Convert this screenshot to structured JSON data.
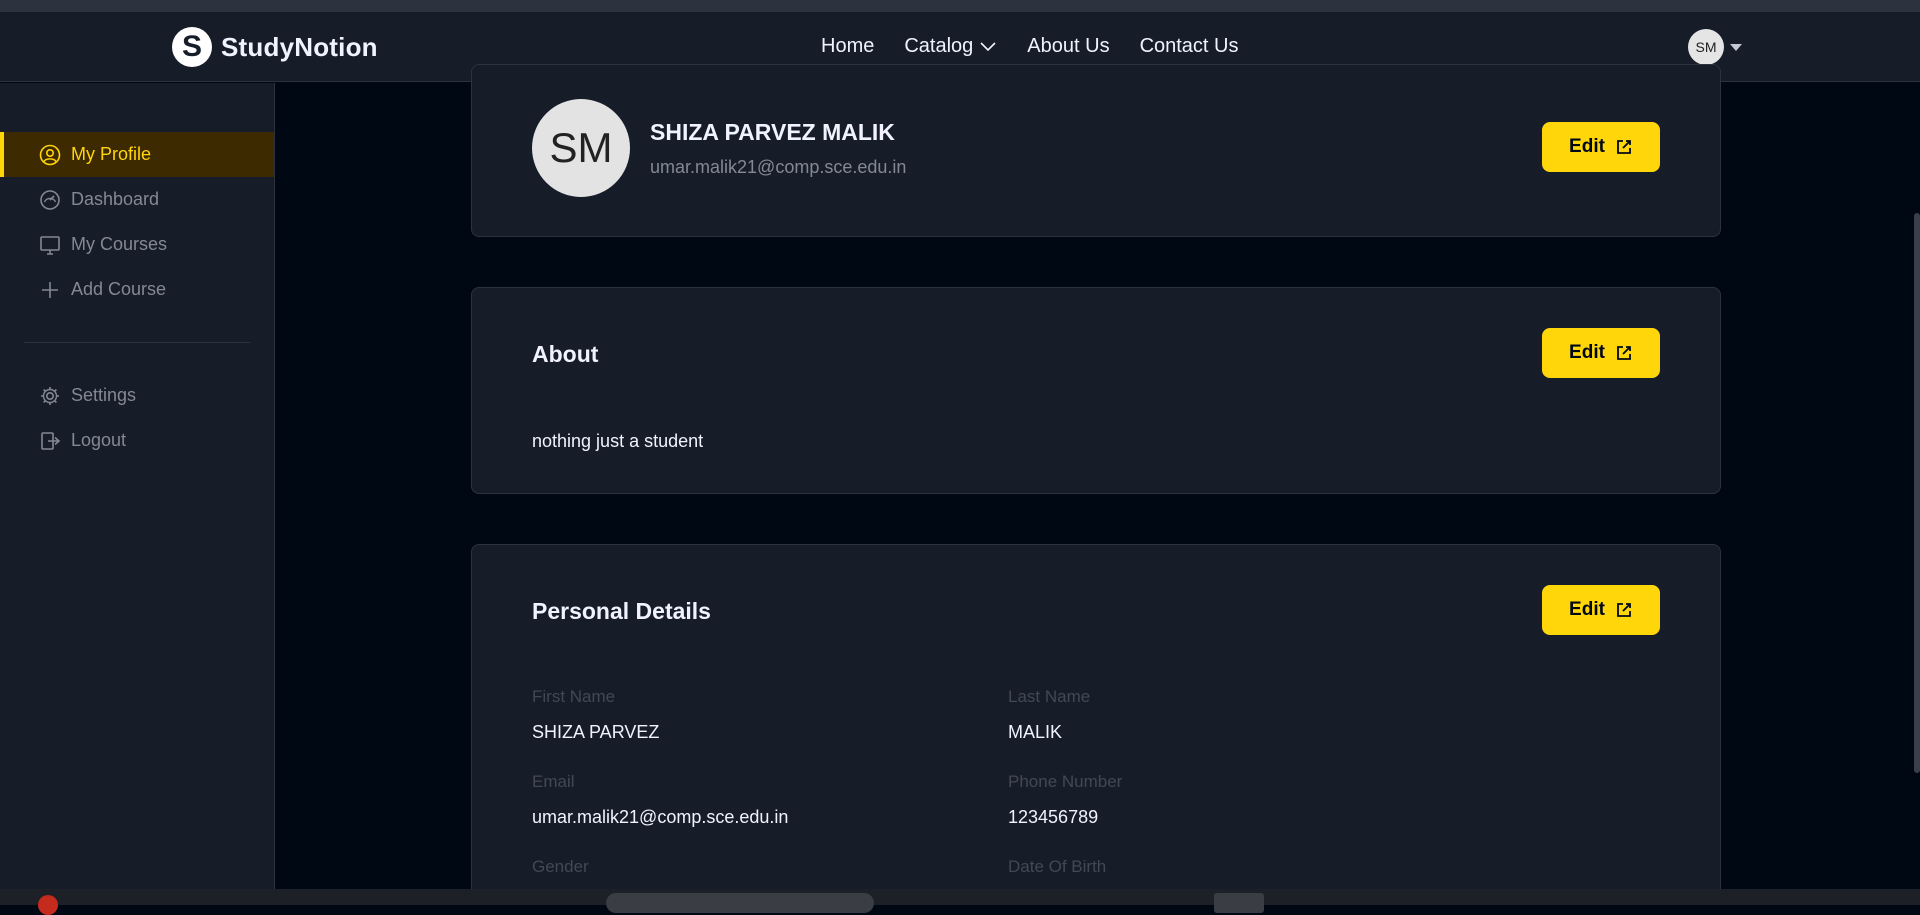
{
  "app": {
    "brand": "StudyNotion",
    "brand_mark": "S"
  },
  "nav": {
    "home": "Home",
    "catalog": "Catalog",
    "about": "About Us",
    "contact": "Contact Us",
    "avatar_initials": "SM"
  },
  "sidebar": {
    "items": [
      {
        "label": "My Profile",
        "icon": "user-circle-icon",
        "active": true
      },
      {
        "label": "Dashboard",
        "icon": "dashboard-gauge-icon",
        "active": false
      },
      {
        "label": "My Courses",
        "icon": "monitor-icon",
        "active": false
      },
      {
        "label": "Add Course",
        "icon": "plus-icon",
        "active": false
      }
    ],
    "bottom_items": [
      {
        "label": "Settings",
        "icon": "gear-icon"
      },
      {
        "label": "Logout",
        "icon": "logout-icon"
      }
    ]
  },
  "profile": {
    "initials": "SM",
    "name": "SHIZA PARVEZ MALIK",
    "email": "umar.malik21@comp.sce.edu.in",
    "edit_label": "Edit"
  },
  "about": {
    "title": "About",
    "text": "nothing just a student",
    "edit_label": "Edit"
  },
  "personal": {
    "title": "Personal Details",
    "edit_label": "Edit",
    "fields": {
      "first_name_label": "First Name",
      "first_name_value": "SHIZA PARVEZ",
      "last_name_label": "Last Name",
      "last_name_value": "MALIK",
      "email_label": "Email",
      "email_value": "umar.malik21@comp.sce.edu.in",
      "phone_label": "Phone Number",
      "phone_value": "123456789",
      "gender_label": "Gender",
      "dob_label": "Date Of Birth"
    }
  },
  "colors": {
    "accent": "#ffd60a",
    "background": "#000814",
    "panel": "#161d29",
    "border": "#2c333f",
    "muted_text": "#838894"
  }
}
